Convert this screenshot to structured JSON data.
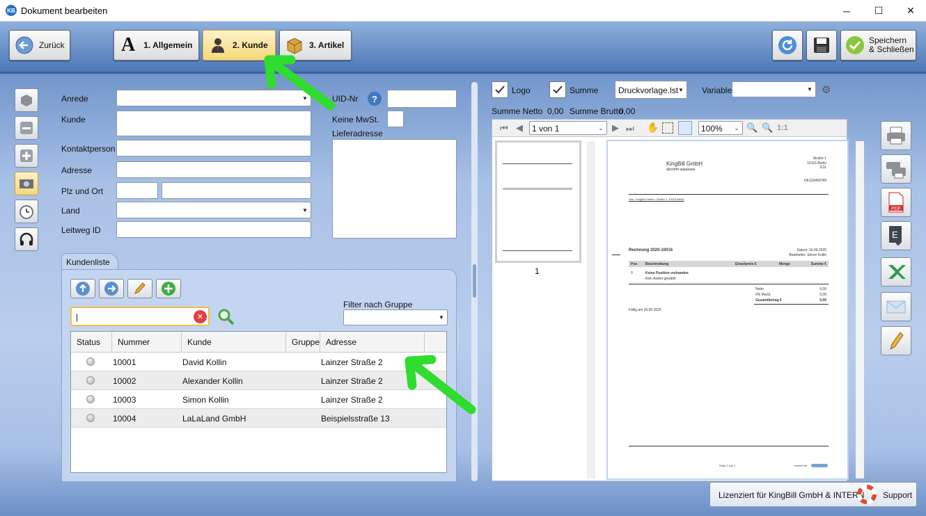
{
  "window": {
    "title": "Dokument bearbeiten",
    "icon_text": "KB",
    "min": "─",
    "max": "☐",
    "close": "✕"
  },
  "toolbar": {
    "back_label": "Zurück",
    "tab_general": "1. Allgemein",
    "tab_customer": "2. Kunde",
    "tab_article": "3. Artikel",
    "save_close_line1": "Speichern",
    "save_close_line2": "& Schließen"
  },
  "form": {
    "anrede_label": "Anrede",
    "kunde_label": "Kunde",
    "kontakt_label": "Kontaktperson",
    "adresse_label": "Adresse",
    "plz_ort_label": "Plz und Ort",
    "land_label": "Land",
    "leitweg_label": "Leitweg ID",
    "uid_label": "UID-Nr",
    "uid_help": "?",
    "keine_mwst_label": "Keine MwSt.",
    "lieferadresse_label": "Lieferadresse"
  },
  "customer_list": {
    "tab_label": "Kundenliste",
    "filter_label": "Filter nach Gruppe",
    "search_value": "|",
    "columns": [
      "Status",
      "Nummer",
      "Kunde",
      "Gruppe",
      "Adresse"
    ],
    "rows": [
      {
        "nummer": "10001",
        "kunde": "David Kollin",
        "gruppe": "",
        "adresse": "Lainzer Straße 2"
      },
      {
        "nummer": "10002",
        "kunde": "Alexander Kollin",
        "gruppe": "",
        "adresse": "Lainzer Straße 2"
      },
      {
        "nummer": "10003",
        "kunde": "Simon Kollin",
        "gruppe": "",
        "adresse": "Lainzer Straße 2"
      },
      {
        "nummer": "10004",
        "kunde": "LaLaLand GmbH",
        "gruppe": "",
        "adresse": "Beispielsstraße 13"
      }
    ]
  },
  "preview": {
    "logo_label": "Logo",
    "summe_label": "Summe",
    "template_value": "Druckvorlage.lst",
    "variable_label": "Variable",
    "netto_label": "Summe Netto",
    "netto_value": "0,00",
    "brutto_label": "Summe Brutto",
    "brutto_value": "0,00",
    "page_value": "1 von 1",
    "zoom_value": "100%",
    "zoom_ratio": "1:1",
    "thumb_page": "1"
  },
  "document": {
    "company": "KingBill GmbH",
    "company_sub": "abcdefd aaaaaaaa",
    "street": "Straße 1",
    "city": "10115 Berlin",
    "code": "1111",
    "uid": "DE123456789",
    "sender_line": "Abs.: KingBill GmbH • Straße 1, 10115 Berlin",
    "invoice_title": "Rechnung 2020-10016",
    "date_line": "Datum: 16.06.2025",
    "clerk_line": "Bearbeiter: Simon Kollin",
    "col_pos": "Pos",
    "col_desc": "Beschreibung",
    "col_unit": "Einzelpreis €",
    "col_qty": "Menge",
    "col_sum": "Summe €",
    "pos_no": "0",
    "no_positions": "Keine Position vorhanden",
    "no_article": "Kein Artikel gewählt",
    "netto": "Netto",
    "netto_val": "0,00",
    "mwst": "0% MwSt.",
    "mwst_val": "0,00",
    "total": "Gesamtbetrag €",
    "total_val": "0,00",
    "due": "Fällig am 30.06.2025",
    "footer_page": "Seite 1 von 1",
    "footer_created": "erstellt mit"
  },
  "footer": {
    "license": "Lizenziert für KingBill GmbH & INTERN",
    "support": "Support"
  },
  "colors": {
    "annotation_arrow": "#2fdc2f",
    "accent": "#2a6fc2"
  }
}
